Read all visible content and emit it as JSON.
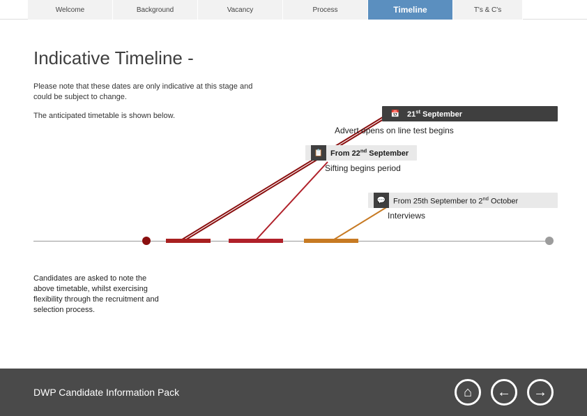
{
  "tabs": {
    "welcome": "Welcome",
    "background": "Background",
    "vacancy": "Vacancy",
    "process": "Process",
    "timeline": "Timeline",
    "tsandcs": "T's & C's"
  },
  "title": "Indicative Timeline -",
  "intro1": "Please note that these dates are only indicative at this stage and could be subject to change.",
  "intro2": "The anticipated timetable is shown below.",
  "events": {
    "e1_date_day": "21",
    "e1_date_suffix": "st",
    "e1_date_month": " September",
    "e1_desc": "Advert opens on line test begins",
    "e2_prefix": "From ",
    "e2_day": "22",
    "e2_suffix": "nd",
    "e2_month": " September",
    "e2_desc": "Sifting begins  period",
    "e3_text_a": "From 25th September to 2",
    "e3_text_b": "nd",
    "e3_text_c": " October",
    "e3_desc": "Interviews"
  },
  "note": "Candidates are asked to note the above timetable, whilst exercising flexibility through the recruitment and selection process.",
  "footer": {
    "title": "DWP Candidate Information Pack"
  },
  "icons": {
    "calendar": "📅",
    "clipboard": "📋",
    "chat": "💬",
    "home": "⌂",
    "prev": "←",
    "next": "→"
  }
}
